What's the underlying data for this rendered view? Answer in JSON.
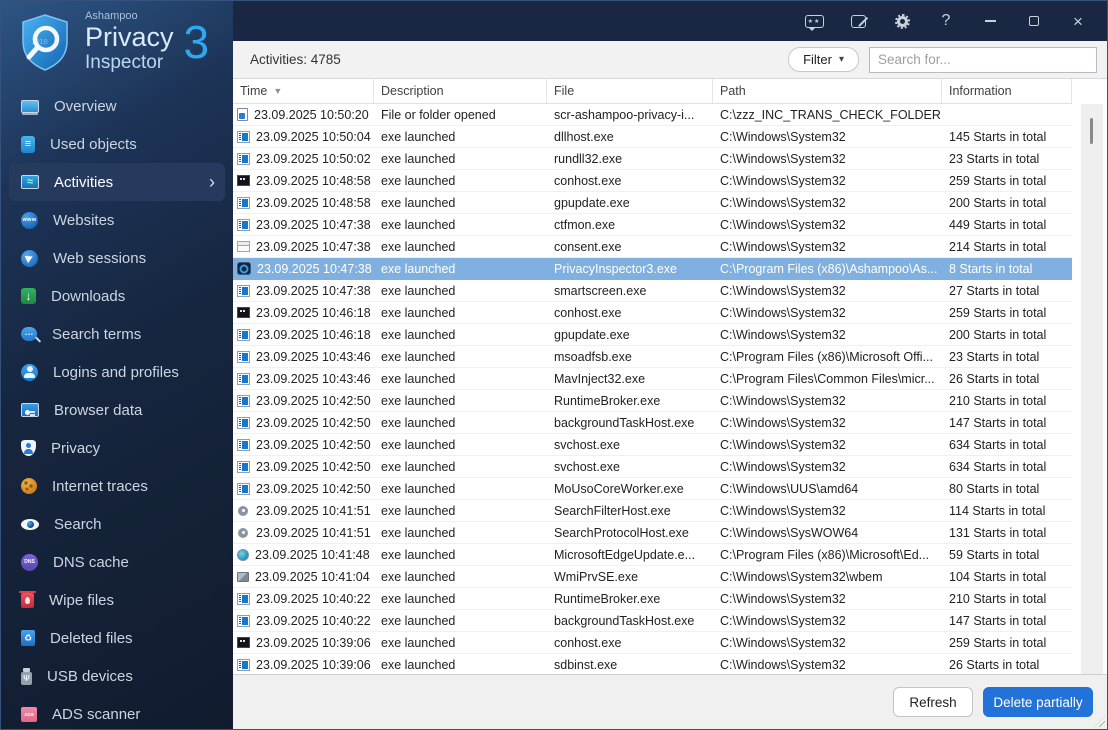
{
  "logo": {
    "brand": "Ashampoo",
    "name_line1": "Privacy",
    "name_line2": "Inspector",
    "version": "3"
  },
  "titlebar": {
    "icons": [
      "feedback",
      "notes",
      "settings-gear",
      "help",
      "minimize",
      "maximize",
      "close"
    ],
    "help_glyph": "?",
    "close_glyph": "×",
    "feedback_stars": "★★"
  },
  "sidebar": {
    "selected_index": 2,
    "chevron_glyph": "›",
    "items": [
      {
        "id": "overview",
        "label": "Overview",
        "icon": "laptop"
      },
      {
        "id": "used-objects",
        "label": "Used objects",
        "icon": "doc"
      },
      {
        "id": "activities",
        "label": "Activities",
        "icon": "activities"
      },
      {
        "id": "websites",
        "label": "Websites",
        "icon": "websites",
        "icon_text": "www"
      },
      {
        "id": "web-sessions",
        "label": "Web sessions",
        "icon": "web-sessions"
      },
      {
        "id": "downloads",
        "label": "Downloads",
        "icon": "downloads"
      },
      {
        "id": "search-terms",
        "label": "Search terms",
        "icon": "search-terms"
      },
      {
        "id": "logins-and-profiles",
        "label": "Logins and profiles",
        "icon": "logins"
      },
      {
        "id": "browser-data",
        "label": "Browser data",
        "icon": "browser"
      },
      {
        "id": "privacy",
        "label": "Privacy",
        "icon": "shield"
      },
      {
        "id": "internet-traces",
        "label": "Internet traces",
        "icon": "cookie"
      },
      {
        "id": "search",
        "label": "Search",
        "icon": "eye"
      },
      {
        "id": "dns-cache",
        "label": "DNS cache",
        "icon": "dns",
        "icon_text": "DNS"
      },
      {
        "id": "wipe-files",
        "label": "Wipe files",
        "icon": "wipe"
      },
      {
        "id": "deleted-files",
        "label": "Deleted files",
        "icon": "recycle"
      },
      {
        "id": "usb-devices",
        "label": "USB devices",
        "icon": "usb"
      },
      {
        "id": "ads-scanner",
        "label": "ADS scanner",
        "icon": "ads",
        "icon_text": "ADS"
      }
    ]
  },
  "toolbar": {
    "count_label": "Activities: 4785",
    "filter_label": "Filter",
    "filter_caret": "▾",
    "search_placeholder": "Search for..."
  },
  "table": {
    "sort": {
      "column": "Time",
      "direction": "desc",
      "glyph": "▼"
    },
    "columns": [
      {
        "label": "Time",
        "sorted": true
      },
      {
        "label": "Description"
      },
      {
        "label": "File"
      },
      {
        "label": "Path"
      },
      {
        "label": "Information"
      }
    ],
    "rows": [
      {
        "icon": "file",
        "time": "23.09.2025 10:50:20",
        "description": "File or folder opened",
        "file": "scr-ashampoo-privacy-i...",
        "path": "C:\\zzz_INC_TRANS_CHECK_FOLDER",
        "information": ""
      },
      {
        "icon": "exe-window",
        "time": "23.09.2025 10:50:04",
        "description": "exe launched",
        "file": "dllhost.exe",
        "path": "C:\\Windows\\System32",
        "information": "145 Starts in total"
      },
      {
        "icon": "exe-window",
        "time": "23.09.2025 10:50:02",
        "description": "exe launched",
        "file": "rundll32.exe",
        "path": "C:\\Windows\\System32",
        "information": "23 Starts in total"
      },
      {
        "icon": "console-window",
        "time": "23.09.2025 10:48:58",
        "description": "exe launched",
        "file": "conhost.exe",
        "path": "C:\\Windows\\System32",
        "information": "259 Starts in total"
      },
      {
        "icon": "exe-window",
        "time": "23.09.2025 10:48:58",
        "description": "exe launched",
        "file": "gpupdate.exe",
        "path": "C:\\Windows\\System32",
        "information": "200 Starts in total"
      },
      {
        "icon": "exe-window",
        "time": "23.09.2025 10:47:38",
        "description": "exe launched",
        "file": "ctfmon.exe",
        "path": "C:\\Windows\\System32",
        "information": "449 Starts in total"
      },
      {
        "icon": "plain-window",
        "time": "23.09.2025 10:47:38",
        "description": "exe launched",
        "file": "consent.exe",
        "path": "C:\\Windows\\System32",
        "information": "214 Starts in total"
      },
      {
        "icon": "privacy-inspector-app",
        "time": "23.09.2025 10:47:38",
        "description": "exe launched",
        "file": "PrivacyInspector3.exe",
        "path": "C:\\Program Files (x86)\\Ashampoo\\As...",
        "information": "8 Starts in total",
        "selected": true
      },
      {
        "icon": "exe-window",
        "time": "23.09.2025 10:47:38",
        "description": "exe launched",
        "file": "smartscreen.exe",
        "path": "C:\\Windows\\System32",
        "information": "27 Starts in total"
      },
      {
        "icon": "console-window",
        "time": "23.09.2025 10:46:18",
        "description": "exe launched",
        "file": "conhost.exe",
        "path": "C:\\Windows\\System32",
        "information": "259 Starts in total"
      },
      {
        "icon": "exe-window",
        "time": "23.09.2025 10:46:18",
        "description": "exe launched",
        "file": "gpupdate.exe",
        "path": "C:\\Windows\\System32",
        "information": "200 Starts in total"
      },
      {
        "icon": "exe-window",
        "time": "23.09.2025 10:43:46",
        "description": "exe launched",
        "file": "msoadfsb.exe",
        "path": "C:\\Program Files (x86)\\Microsoft Offi...",
        "information": "23 Starts in total"
      },
      {
        "icon": "exe-window",
        "time": "23.09.2025 10:43:46",
        "description": "exe launched",
        "file": "MavInject32.exe",
        "path": "C:\\Program Files\\Common Files\\micr...",
        "information": "26 Starts in total"
      },
      {
        "icon": "exe-window",
        "time": "23.09.2025 10:42:50",
        "description": "exe launched",
        "file": "RuntimeBroker.exe",
        "path": "C:\\Windows\\System32",
        "information": "210 Starts in total"
      },
      {
        "icon": "exe-window",
        "time": "23.09.2025 10:42:50",
        "description": "exe launched",
        "file": "backgroundTaskHost.exe",
        "path": "C:\\Windows\\System32",
        "information": "147 Starts in total"
      },
      {
        "icon": "exe-window",
        "time": "23.09.2025 10:42:50",
        "description": "exe launched",
        "file": "svchost.exe",
        "path": "C:\\Windows\\System32",
        "information": "634 Starts in total"
      },
      {
        "icon": "exe-window",
        "time": "23.09.2025 10:42:50",
        "description": "exe launched",
        "file": "svchost.exe",
        "path": "C:\\Windows\\System32",
        "information": "634 Starts in total"
      },
      {
        "icon": "exe-window",
        "time": "23.09.2025 10:42:50",
        "description": "exe launched",
        "file": "MoUsoCoreWorker.exe",
        "path": "C:\\Windows\\UUS\\amd64",
        "information": "80 Starts in total"
      },
      {
        "icon": "search-gear",
        "time": "23.09.2025 10:41:51",
        "description": "exe launched",
        "file": "SearchFilterHost.exe",
        "path": "C:\\Windows\\System32",
        "information": "114 Starts in total"
      },
      {
        "icon": "search-gear",
        "time": "23.09.2025 10:41:51",
        "description": "exe launched",
        "file": "SearchProtocolHost.exe",
        "path": "C:\\Windows\\SysWOW64",
        "information": "131 Starts in total"
      },
      {
        "icon": "edge-globe",
        "time": "23.09.2025 10:41:48",
        "description": "exe launched",
        "file": "MicrosoftEdgeUpdate.e...",
        "path": "C:\\Program Files (x86)\\Microsoft\\Ed...",
        "information": "59 Starts in total"
      },
      {
        "icon": "wmi-audio",
        "time": "23.09.2025 10:41:04",
        "description": "exe launched",
        "file": "WmiPrvSE.exe",
        "path": "C:\\Windows\\System32\\wbem",
        "information": "104 Starts in total"
      },
      {
        "icon": "exe-window",
        "time": "23.09.2025 10:40:22",
        "description": "exe launched",
        "file": "RuntimeBroker.exe",
        "path": "C:\\Windows\\System32",
        "information": "210 Starts in total"
      },
      {
        "icon": "exe-window",
        "time": "23.09.2025 10:40:22",
        "description": "exe launched",
        "file": "backgroundTaskHost.exe",
        "path": "C:\\Windows\\System32",
        "information": "147 Starts in total"
      },
      {
        "icon": "console-window",
        "time": "23.09.2025 10:39:06",
        "description": "exe launched",
        "file": "conhost.exe",
        "path": "C:\\Windows\\System32",
        "information": "259 Starts in total"
      },
      {
        "icon": "exe-window",
        "time": "23.09.2025 10:39:06",
        "description": "exe launched",
        "file": "sdbinst.exe",
        "path": "C:\\Windows\\System32",
        "information": "26 Starts in total"
      }
    ]
  },
  "footer": {
    "refresh_label": "Refresh",
    "delete_label": "Delete partially"
  },
  "colors": {
    "titlebar_bg": "#1a2742",
    "sidebar_top": "#2d5585",
    "sidebar_bottom": "#121b2e",
    "accent_blue": "#2fa8f0",
    "selected_row_bg": "#7fb0e0",
    "selected_nav_bg": "#253a5c",
    "delete_button_bg": "#2172d9",
    "toolbar_bg": "#f2f2f2"
  }
}
